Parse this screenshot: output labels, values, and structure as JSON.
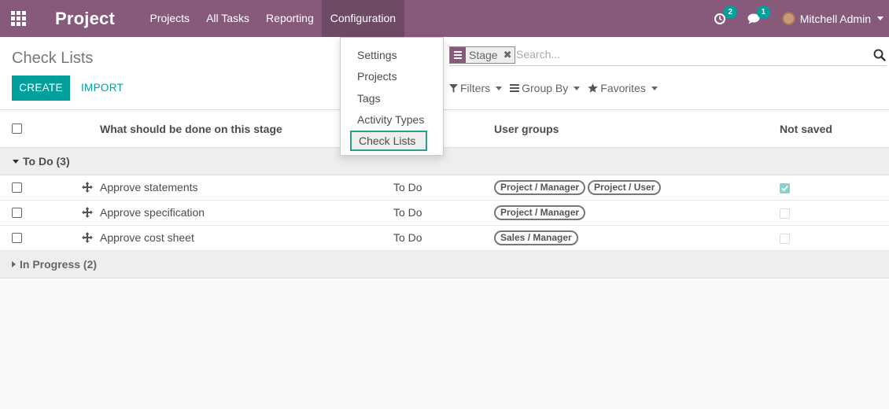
{
  "navbar": {
    "brand": "Project",
    "menu": [
      "Projects",
      "All Tasks",
      "Reporting",
      "Configuration"
    ],
    "activity_count": "2",
    "messages_count": "1",
    "user_name": "Mitchell Admin"
  },
  "config_menu": {
    "items": [
      "Settings",
      "Projects",
      "Tags",
      "Activity Types",
      "Check Lists"
    ],
    "selected": "Check Lists"
  },
  "control_panel": {
    "title": "Check Lists",
    "create_label": "CREATE",
    "import_label": "IMPORT",
    "facet_value": "Stage",
    "search_placeholder": "Search...",
    "filters_label": "Filters",
    "groupby_label": "Group By",
    "favorites_label": "Favorites"
  },
  "list": {
    "columns": {
      "description": "What should be done on this stage",
      "user_groups": "User groups",
      "not_saved": "Not saved"
    },
    "groups": [
      {
        "label": "To Do (3)",
        "expanded": true,
        "rows": [
          {
            "name": "Approve statements",
            "stage": "To Do",
            "groups": [
              "Project / Manager",
              "Project / User"
            ],
            "not_saved": true
          },
          {
            "name": "Approve specification",
            "stage": "To Do",
            "groups": [
              "Project / Manager"
            ],
            "not_saved": false
          },
          {
            "name": "Approve cost sheet",
            "stage": "To Do",
            "groups": [
              "Sales / Manager"
            ],
            "not_saved": false
          }
        ]
      },
      {
        "label": "In Progress (2)",
        "expanded": false,
        "rows": []
      }
    ]
  },
  "colors": {
    "brand": "#875a7b",
    "accent": "#00a09d",
    "selected_border": "#2e9c86"
  }
}
